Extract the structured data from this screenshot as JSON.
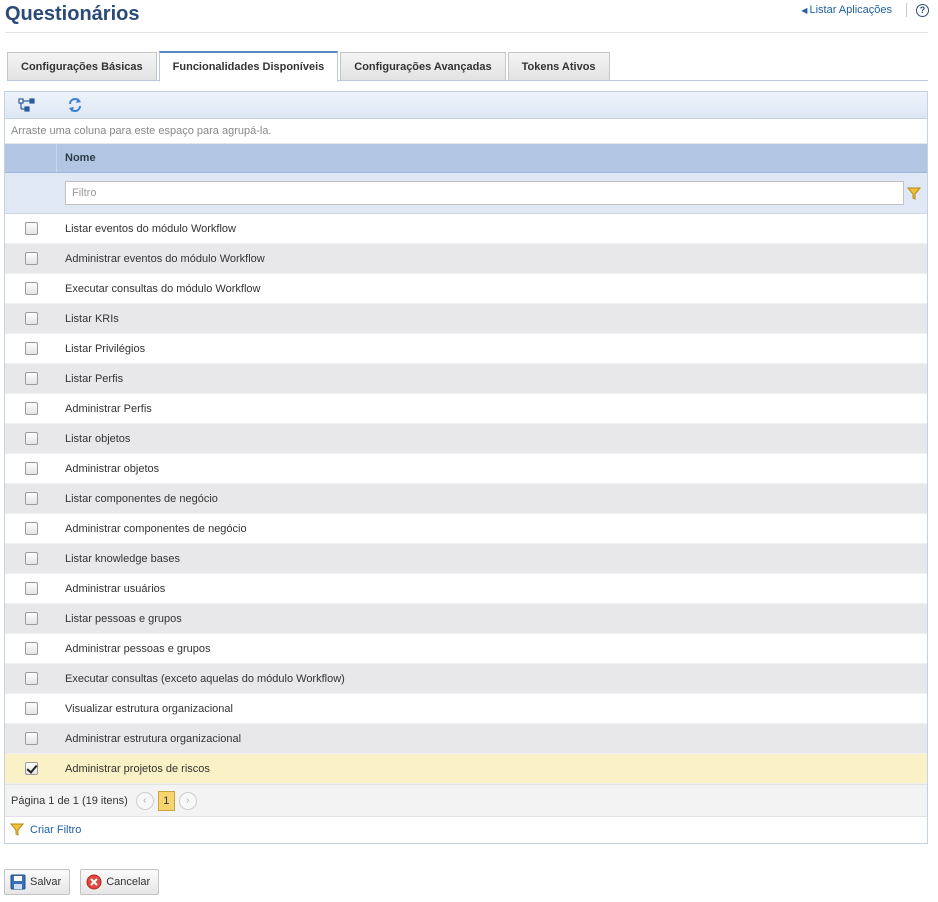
{
  "page": {
    "title": "Questionários",
    "list_apps_link": "Listar Aplicações",
    "help_symbol": "?"
  },
  "tabs": [
    {
      "label": "Configurações Básicas",
      "active": false
    },
    {
      "label": "Funcionalidades Disponíveis",
      "active": true
    },
    {
      "label": "Configurações Avançadas",
      "active": false
    },
    {
      "label": "Tokens Ativos",
      "active": false
    }
  ],
  "toolbar": {
    "icons": [
      "hierarchy-icon",
      "refresh-icon"
    ]
  },
  "grid": {
    "group_hint": "Arraste uma coluna para este espaço para agrupá-la.",
    "column_name": "Nome",
    "filter_placeholder": "Filtro",
    "filter_value": "",
    "rows": [
      {
        "name": "Listar eventos do módulo Workflow",
        "checked": false
      },
      {
        "name": "Administrar eventos do módulo Workflow",
        "checked": false
      },
      {
        "name": "Executar consultas do módulo Workflow",
        "checked": false
      },
      {
        "name": "Listar KRIs",
        "checked": false
      },
      {
        "name": "Listar Privilégios",
        "checked": false
      },
      {
        "name": "Listar Perfis",
        "checked": false
      },
      {
        "name": "Administrar Perfis",
        "checked": false
      },
      {
        "name": "Listar objetos",
        "checked": false
      },
      {
        "name": "Administrar objetos",
        "checked": false
      },
      {
        "name": "Listar componentes de negócio",
        "checked": false
      },
      {
        "name": "Administrar componentes de negócio",
        "checked": false
      },
      {
        "name": "Listar knowledge bases",
        "checked": false
      },
      {
        "name": "Administrar usuários",
        "checked": false
      },
      {
        "name": "Listar pessoas e grupos",
        "checked": false
      },
      {
        "name": "Administrar pessoas e grupos",
        "checked": false
      },
      {
        "name": "Executar consultas (exceto aquelas do módulo Workflow)",
        "checked": false
      },
      {
        "name": "Visualizar estrutura organizacional",
        "checked": false
      },
      {
        "name": "Administrar estrutura organizacional",
        "checked": false
      },
      {
        "name": "Administrar projetos de riscos",
        "checked": true
      }
    ],
    "pager": {
      "summary": "Página 1 de 1 (19 itens)",
      "current_page": "1",
      "prev_symbol": "‹",
      "next_symbol": "›"
    },
    "create_filter": "Criar Filtro"
  },
  "actions": {
    "save": "Salvar",
    "cancel": "Cancelar"
  },
  "colors": {
    "title": "#2b4a78",
    "link": "#1f5fa8",
    "header": "#b2c6e3",
    "selected_row": "#faf2c6",
    "page_active": "#f7d46e"
  }
}
